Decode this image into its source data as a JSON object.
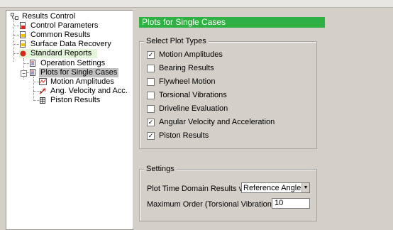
{
  "tree": {
    "root": "Results Control",
    "items": [
      {
        "label": "Control Parameters",
        "icon": "doc-red-icon"
      },
      {
        "label": "Common Results",
        "icon": "doc-yellow-icon"
      },
      {
        "label": "Surface Data Recovery",
        "icon": "doc-yellow-icon"
      },
      {
        "label": "Standard Reports",
        "icon": "red-dot-icon"
      },
      {
        "label": "Operation Settings",
        "icon": "doc-icon"
      },
      {
        "label": "Plots for Single Cases",
        "icon": "doc-icon"
      },
      {
        "label": "Motion Amplitudes",
        "icon": "chart-icon"
      },
      {
        "label": "Ang. Velocity and Acc.",
        "icon": "arrow-icon"
      },
      {
        "label": "Piston Results",
        "icon": "grid-icon"
      }
    ]
  },
  "panel": {
    "title": "Plots for Single Cases",
    "plot_types": {
      "legend": "Select Plot Types",
      "options": [
        {
          "label": "Motion Amplitudes",
          "checked": true
        },
        {
          "label": "Bearing Results",
          "checked": false
        },
        {
          "label": "Flywheel Motion",
          "checked": false
        },
        {
          "label": "Torsional Vibrations",
          "checked": false
        },
        {
          "label": "Driveline Evaluation",
          "checked": false
        },
        {
          "label": "Angular Velocity and Acceleration",
          "checked": true
        },
        {
          "label": "Piston Results",
          "checked": true
        }
      ]
    },
    "settings": {
      "legend": "Settings",
      "time_domain_label": "Plot Time Domain Results vs",
      "time_domain_value": "Reference Angle",
      "max_order_label": "Maximum Order (Torsional Vibrations)",
      "max_order_value": "10"
    }
  }
}
